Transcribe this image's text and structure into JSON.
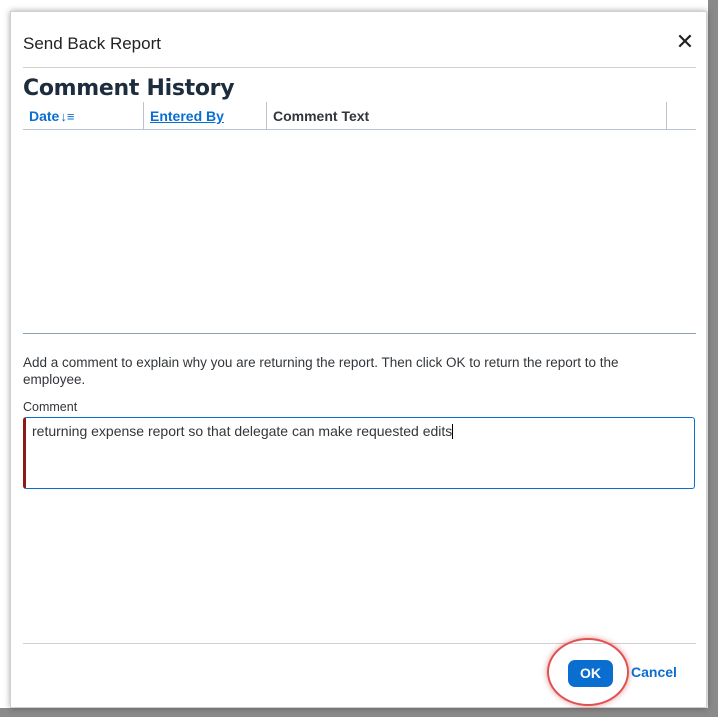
{
  "dialog": {
    "title": "Send Back Report",
    "close_icon": "close-icon"
  },
  "comment_history": {
    "heading": "Comment History",
    "columns": [
      {
        "label": "Date",
        "sort_icon": "sort-descending-icon",
        "glyph": "↓≡"
      },
      {
        "label": "Entered By"
      },
      {
        "label": "Comment Text"
      }
    ],
    "rows": []
  },
  "instructions": "Add a comment to explain why you are returning the report. Then click OK to return the report to the employee.",
  "comment": {
    "label": "Comment",
    "value": "returning expense report so that delegate can make requested edits"
  },
  "footer": {
    "ok_label": "OK",
    "cancel_label": "Cancel"
  },
  "colors": {
    "accent": "#0a6ed1",
    "highlight_ring": "#e05050",
    "error_border": "#8b1a1a"
  }
}
